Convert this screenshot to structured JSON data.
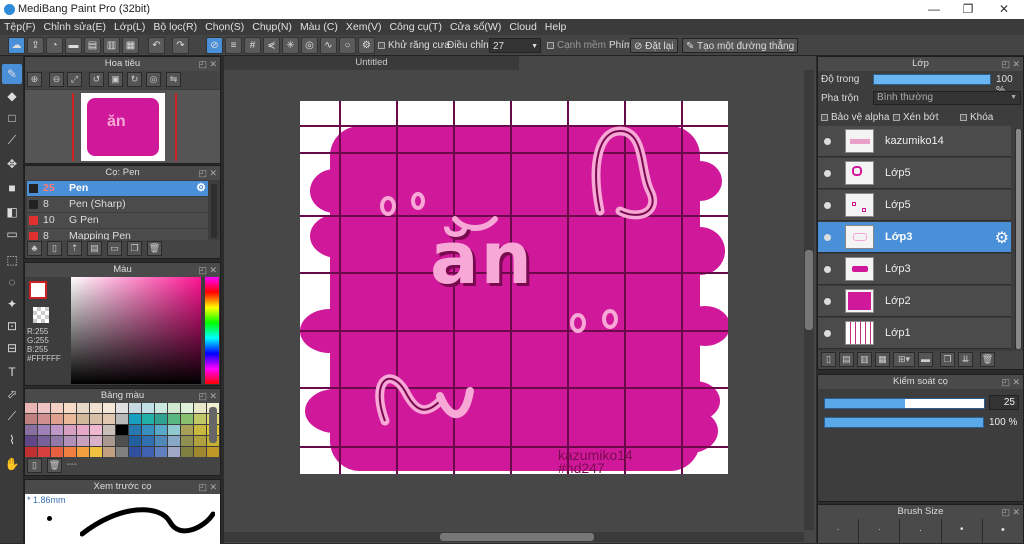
{
  "window": {
    "title": "MediBang Paint Pro (32bit)",
    "minimize": "—",
    "maximize": "❐",
    "close": "✕"
  },
  "menu": [
    "Tệp(F)",
    "Chỉnh sửa(E)",
    "Lớp(L)",
    "Bộ lọc(R)",
    "Chọn(S)",
    "Chụp(N)",
    "Màu (C)",
    "Xem(V)",
    "Công cụ(T)",
    "Cửa sổ(W)",
    "Cloud",
    "Help"
  ],
  "toolbar": {
    "antialias": "Khử răng cưa",
    "adjust_label": "Điều chỉnh",
    "adjust_value": "27",
    "smooth": "Cạnh mềm",
    "phim": "Phím",
    "reset": "Đặt lại",
    "create_line": "Tạo một đường thẳng"
  },
  "navigator": {
    "title": "Hoa tiêu"
  },
  "brush_panel": {
    "title": "Cọ: Pen",
    "items": [
      {
        "size": "25",
        "name": "Pen",
        "color": "#222222",
        "selected": true
      },
      {
        "size": "8",
        "name": "Pen (Sharp)",
        "color": "#222222",
        "selected": false
      },
      {
        "size": "10",
        "name": "G Pen",
        "color": "#e03030",
        "selected": false
      },
      {
        "size": "8",
        "name": "Mapping Pen",
        "color": "#e03030",
        "selected": false
      }
    ]
  },
  "color_panel": {
    "title": "Màu",
    "r": "R:255",
    "g": "G:255",
    "b": "B:255",
    "hex": "#FFFFFF"
  },
  "palette_panel": {
    "title": "Bảng màu",
    "dashes": "---"
  },
  "preview_panel": {
    "title": "Xem trước cọ",
    "size": "1.86mm"
  },
  "canvas": {
    "tab": "Untitled",
    "text_main": "ăn",
    "watermark_line1": "kazumiko14",
    "watermark_line2": "#hd247"
  },
  "layer_panel": {
    "title": "Lớp",
    "opacity_label": "Độ trong",
    "opacity_value": "100 %",
    "opacity_fraction": 1.0,
    "blend_label": "Pha trộn",
    "blend_value": "Bình thường",
    "protect_alpha": "Bảo vệ alpha",
    "clip": "Xén bớt",
    "lock": "Khóa",
    "layers": [
      {
        "name": "kazumiko14",
        "selected": false
      },
      {
        "name": "Lớp5",
        "selected": false
      },
      {
        "name": "Lớp5",
        "selected": false
      },
      {
        "name": "Lớp3",
        "selected": true
      },
      {
        "name": "Lớp3",
        "selected": false
      },
      {
        "name": "Lớp2",
        "selected": false
      },
      {
        "name": "Lớp1",
        "selected": false
      }
    ]
  },
  "brush_control": {
    "title": "Kiểm soát cọ",
    "size_value": "25",
    "size_fraction": 0.5,
    "opacity_value": "100 %",
    "opacity_fraction": 1.0
  },
  "brush_size_panel": {
    "title": "Brush Size"
  },
  "colors": {
    "accent": "#4a90d9",
    "magenta": "#d0189a",
    "pink_text": "#f7a8d6",
    "grid": "#6a0a4a"
  }
}
